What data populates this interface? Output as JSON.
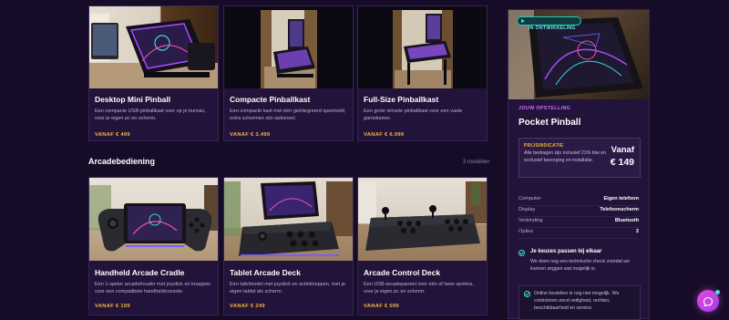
{
  "sections": {
    "arcade": {
      "title": "Arcadebediening",
      "count": "3 modellen"
    }
  },
  "products": {
    "row1": [
      {
        "name": "Desktop Mini Pinball",
        "desc": "Een compacte USB-pinballkast voor op je bureau, voor je eigen pc en scherm.",
        "price": "VANAF € 499"
      },
      {
        "name": "Compacte Pinballkast",
        "desc": "Een compacte kast met één geïntegreerd speelveld; extra schermen zijn optioneel.",
        "price": "VANAF € 3.499"
      },
      {
        "name": "Full-Size Pinballkast",
        "desc": "Een grote virtuele pinballkast voor een vaste gamekamer.",
        "price": "VANAF € 6.999"
      }
    ],
    "row2": [
      {
        "name": "Handheld Arcade Cradle",
        "desc": "Een 1-speler arcadehouder met joystick en knoppen voor een compatibele handheldconsole.",
        "price": "VANAF € 199"
      },
      {
        "name": "Tablet Arcade Deck",
        "desc": "Een tafelmodel met joystick en actieknoppen, met je eigen tablet als scherm.",
        "price": "VANAF € 249"
      },
      {
        "name": "Arcade Control Deck",
        "desc": "Een USB-arcadepaneel voor één of twee spelers, voor je eigen pc en scherm.",
        "price": "VANAF € 599"
      }
    ]
  },
  "panel": {
    "badge": "IN ONTWIKKELING",
    "eyebrow": "JOUW OPSTELLING",
    "title": "Pocket Pinball",
    "price_box": {
      "label": "PRIJSINDICATIE",
      "text": "Alle bedragen zijn inclusief 21% btw en exclusief bezorging en installatie.",
      "from": "Vanaf",
      "amount": "€ 149"
    },
    "specs": [
      {
        "k": "Computer",
        "v": "Eigen telefoon"
      },
      {
        "k": "Display",
        "v": "Telefoonscherm"
      },
      {
        "k": "Verbinding",
        "v": "Bluetooth"
      },
      {
        "k": "Opties",
        "v": "2"
      }
    ],
    "check": {
      "title": "Je keuzes passen bij elkaar",
      "text": "We doen nog een technische check voordat we kunnen zeggen wat mogelijk is."
    },
    "notice": {
      "text": "Online bestellen is nog niet mogelijk. We controleren eerst veiligheid, rechten, beschikbaarheid en service."
    }
  },
  "chat": {
    "icon": "chat-icon"
  }
}
